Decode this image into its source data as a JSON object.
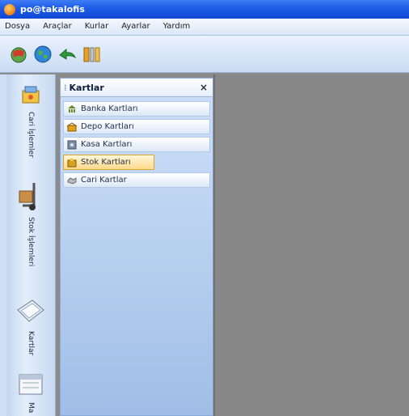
{
  "window": {
    "title": "po@takalofis"
  },
  "menu": [
    "Dosya",
    "Araçlar",
    "Kurlar",
    "Ayarlar",
    "Yardım"
  ],
  "toolbar": {
    "buttons": [
      "globe-flag-icon",
      "earth-icon",
      "back-arrow-icon",
      "tools-icon"
    ]
  },
  "sidebar": {
    "tabs": [
      {
        "label": "Cari İşlemler",
        "icon": "cash-box-icon"
      },
      {
        "label": "Stok İşlemleri",
        "icon": "hand-truck-icon"
      },
      {
        "label": "Kartlar",
        "icon": "card-file-icon"
      },
      {
        "label": "Ma",
        "icon": "calendar-icon"
      }
    ]
  },
  "panel": {
    "title": "Kartlar",
    "close_label": "×",
    "items": [
      {
        "label": "Banka Kartları",
        "icon": "bank-icon",
        "color": "#6a8a2a"
      },
      {
        "label": "Depo Kartları",
        "icon": "warehouse-icon",
        "color": "#e0a020"
      },
      {
        "label": "Kasa Kartları",
        "icon": "safe-icon",
        "color": "#7c8fa8"
      },
      {
        "label": "Stok Kartları",
        "icon": "stock-box-icon",
        "color": "#d8a020",
        "selected": true
      },
      {
        "label": "Cari Kartlar",
        "icon": "handshake-icon",
        "color": "#b9b9b9"
      }
    ]
  }
}
